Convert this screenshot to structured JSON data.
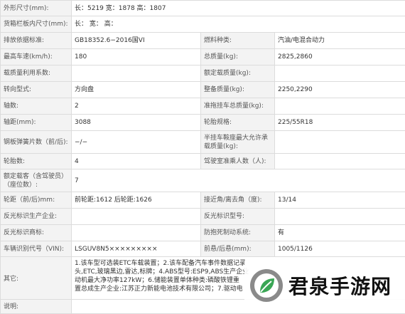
{
  "rows": {
    "r1": {
      "l1": "外形尺寸(mm):",
      "v1": "长：5219 宽：1878 高：1807"
    },
    "r2": {
      "l1": "货箱栏板内尺寸(mm):",
      "v1": "长： 宽： 高："
    },
    "r3": {
      "l1": "排放依据标准:",
      "v1": "GB18352.6−2016国VI",
      "l2": "燃料种类:",
      "v2": "汽油/电混合动力"
    },
    "r4": {
      "l1": "最高车速(km/h):",
      "v1": "180",
      "l2": "总质量(kg):",
      "v2": "2825,2860"
    },
    "r5": {
      "l1": "载质量利用系数:",
      "v1": "",
      "l2": "额定载质量(kg):",
      "v2": ""
    },
    "r6": {
      "l1": "转向型式:",
      "v1": "方向盘",
      "l2": "整备质量(kg):",
      "v2": "2250,2290"
    },
    "r7": {
      "l1": "轴数:",
      "v1": "2",
      "l2": "准拖挂车总质量(kg):",
      "v2": ""
    },
    "r8": {
      "l1": "轴距(mm):",
      "v1": "3088",
      "l2": "轮胎规格:",
      "v2": "225/55R18"
    },
    "r9": {
      "l1": "钢板弹簧片数（前/后):",
      "v1": "−/−",
      "l2": "半挂车鞍座最大允许承载质量(kg):",
      "v2": ""
    },
    "r10": {
      "l1": "轮胎数:",
      "v1": "4",
      "l2": "驾驶室准乘人数（人):",
      "v2": ""
    },
    "r11": {
      "l1": "额定载客（含驾驶员）（座位数）:",
      "v1": "7"
    },
    "r12": {
      "l1": "轮距（前/后)mm:",
      "v1": "前轮距:1612 后轮距:1626",
      "l2": "接近角/离去角（度):",
      "v2": "13/14"
    },
    "r13": {
      "l1": "反光标识生产企业:",
      "v1": "",
      "l2": "反光标识型号:",
      "v2": ""
    },
    "r14": {
      "l1": "反光标识商标:",
      "v1": "",
      "l2": "防抱死制动系统:",
      "v2": "有"
    },
    "r15": {
      "l1": "车辆识别代号（VIN):",
      "v1": "LSGUV8N5×××××××××",
      "l2": "前悬/后悬(mm):",
      "v2": "1005/1126"
    },
    "r16": {
      "l1": "其它:",
      "v1a": "1.该车型可选装ETC车载装置；2.该车配备汽车事件数据记录",
      "v1b": "头,ETC,玻璃黑边,雷达,标牌；4.ABS型号:ESP9,ABS生产企业",
      "v1c": "动机最大净功率127kW；6.储能装置单体种类:磷酸铁锂重",
      "v1d": "置总成生产企业:江苏正力新能电池技术有限公司；7.驱动电"
    },
    "r17": {
      "l1": "说明:"
    }
  },
  "watermark": {
    "text": "君泉手游网",
    "icon": "leaf-logo-icon"
  }
}
